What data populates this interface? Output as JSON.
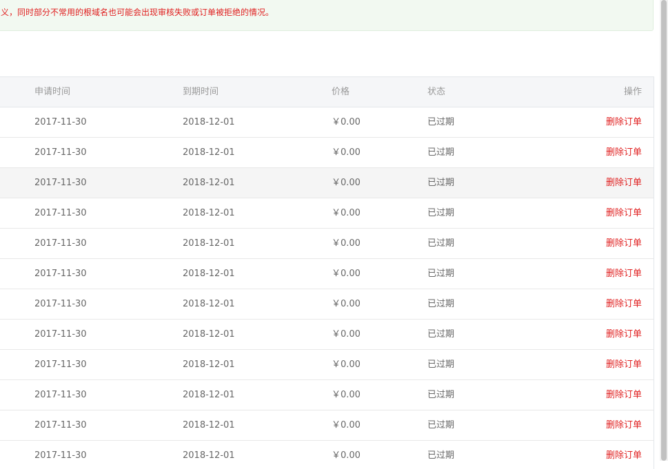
{
  "notice": {
    "text": "义，同时部分不常用的根域名也可能会出现审核失败或订单被拒绝的情况。",
    "color": "#e02020"
  },
  "table": {
    "headers": {
      "apply_time": "申请时间",
      "expire_time": "到期时间",
      "price": "价格",
      "status": "状态",
      "operation": "操作"
    },
    "rows": [
      {
        "apply": "2017-11-30",
        "expire": "2018-12-01",
        "price": "￥0.00",
        "status": "已过期",
        "action": "删除订单"
      },
      {
        "apply": "2017-11-30",
        "expire": "2018-12-01",
        "price": "￥0.00",
        "status": "已过期",
        "action": "删除订单"
      },
      {
        "apply": "2017-11-30",
        "expire": "2018-12-01",
        "price": "￥0.00",
        "status": "已过期",
        "action": "删除订单"
      },
      {
        "apply": "2017-11-30",
        "expire": "2018-12-01",
        "price": "￥0.00",
        "status": "已过期",
        "action": "删除订单"
      },
      {
        "apply": "2017-11-30",
        "expire": "2018-12-01",
        "price": "￥0.00",
        "status": "已过期",
        "action": "删除订单"
      },
      {
        "apply": "2017-11-30",
        "expire": "2018-12-01",
        "price": "￥0.00",
        "status": "已过期",
        "action": "删除订单"
      },
      {
        "apply": "2017-11-30",
        "expire": "2018-12-01",
        "price": "￥0.00",
        "status": "已过期",
        "action": "删除订单"
      },
      {
        "apply": "2017-11-30",
        "expire": "2018-12-01",
        "price": "￥0.00",
        "status": "已过期",
        "action": "删除订单"
      },
      {
        "apply": "2017-11-30",
        "expire": "2018-12-01",
        "price": "￥0.00",
        "status": "已过期",
        "action": "删除订单"
      },
      {
        "apply": "2017-11-30",
        "expire": "2018-12-01",
        "price": "￥0.00",
        "status": "已过期",
        "action": "删除订单"
      },
      {
        "apply": "2017-11-30",
        "expire": "2018-12-01",
        "price": "￥0.00",
        "status": "已过期",
        "action": "删除订单"
      },
      {
        "apply": "2017-11-30",
        "expire": "2018-12-01",
        "price": "￥0.00",
        "status": "已过期",
        "action": "删除订单"
      }
    ],
    "highlighted_row_index": 2
  }
}
